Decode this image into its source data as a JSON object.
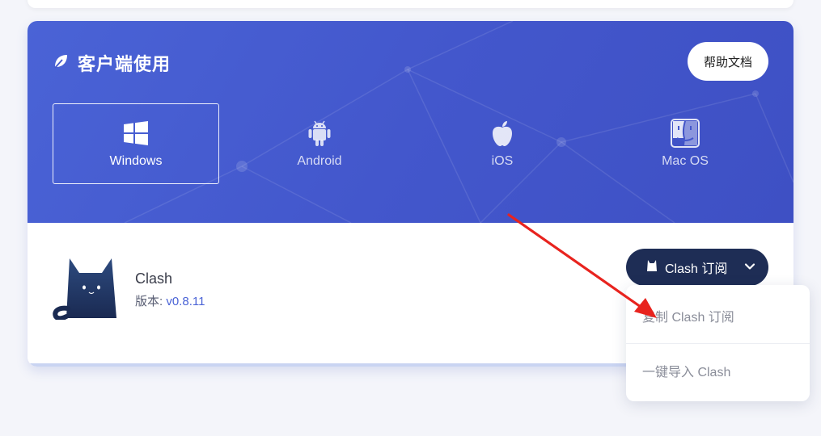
{
  "header": {
    "title": "客户端使用",
    "help_label": "帮助文档"
  },
  "platforms": [
    {
      "label": "Windows",
      "icon": "windows-icon",
      "active": true
    },
    {
      "label": "Android",
      "icon": "android-icon",
      "active": false
    },
    {
      "label": "iOS",
      "icon": "apple-icon",
      "active": false
    },
    {
      "label": "Mac OS",
      "icon": "finder-icon",
      "active": false
    }
  ],
  "app": {
    "name": "Clash",
    "version_prefix": "版本: ",
    "version": "v0.8.11",
    "logo_icon": "clash-cat-icon"
  },
  "subscribe_button": {
    "label": "Clash 订阅",
    "icon": "clash-cat-icon"
  },
  "dropdown": {
    "items": [
      "复制 Clash 订阅",
      "一键导入 Clash"
    ]
  },
  "colors": {
    "header_bg": "#4357cc",
    "button_dark": "#1e2d55",
    "accent": "#4a63d6",
    "arrow": "#e8231e"
  }
}
